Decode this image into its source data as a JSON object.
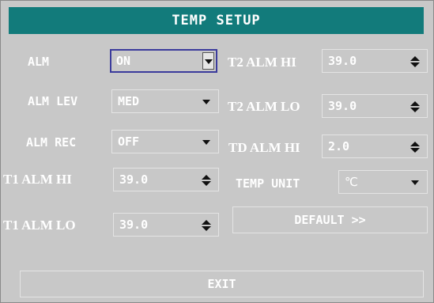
{
  "title": "TEMP SETUP",
  "left": {
    "alm": {
      "label": "ALM",
      "value": "ON",
      "control": "dropdown",
      "focused": true
    },
    "alm_lev": {
      "label": "ALM LEV",
      "value": "MED",
      "control": "dropdown"
    },
    "alm_rec": {
      "label": "ALM REC",
      "value": "OFF",
      "control": "dropdown"
    },
    "t1_alm_hi": {
      "label": "T1 ALM HI",
      "value": "39.0",
      "control": "spinner"
    },
    "t1_alm_lo": {
      "label": "T1 ALM LO",
      "value": "39.0",
      "control": "spinner"
    }
  },
  "right": {
    "t2_alm_hi": {
      "label": "T2 ALM HI",
      "value": "39.0",
      "control": "spinner"
    },
    "t2_alm_lo": {
      "label": "T2 ALM LO",
      "value": "39.0",
      "control": "spinner"
    },
    "td_alm_hi": {
      "label": "TD ALM HI",
      "value": "2.0",
      "control": "spinner"
    },
    "temp_unit": {
      "label": "TEMP UNIT",
      "value": "℃",
      "control": "dropdown"
    }
  },
  "buttons": {
    "default": "DEFAULT >>",
    "exit": "EXIT"
  },
  "colors": {
    "title_bar": "#127b7b",
    "background": "#c8c8c8",
    "text": "#ffffff",
    "focus_border": "#3b3b9c"
  }
}
